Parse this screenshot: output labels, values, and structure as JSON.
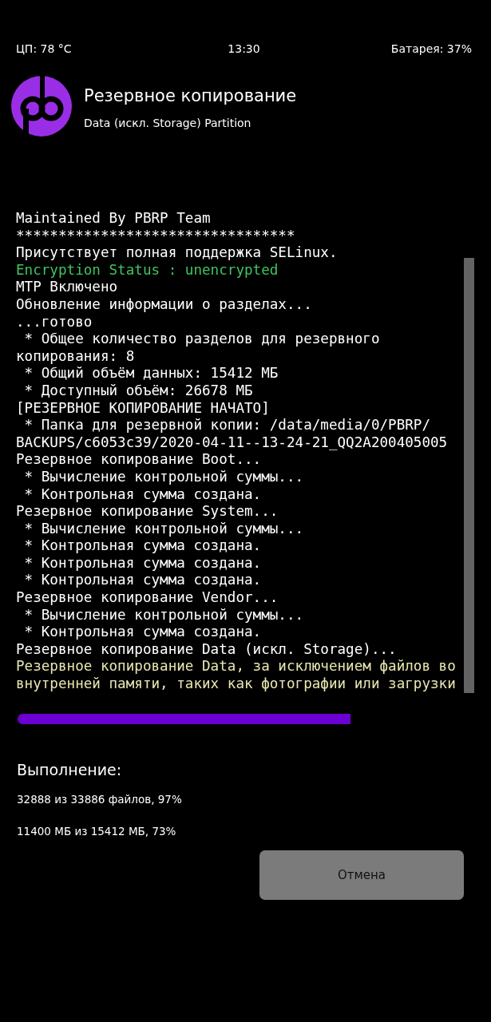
{
  "status_bar": {
    "cpu": "ЦП: 78 °C",
    "time": "13:30",
    "battery": "Батарея: 37%"
  },
  "header": {
    "title": "Резервное копирование",
    "subtitle": "Data (искл. Storage) Partition"
  },
  "console": {
    "lines": [
      {
        "text": "Maintained By PBRP Team",
        "kind": "plain"
      },
      {
        "text": "*********************************",
        "kind": "plain"
      },
      {
        "text": "Присутствует полная поддержка SELinux.",
        "kind": "plain"
      },
      {
        "text": "Encryption Status : unencrypted",
        "kind": "success"
      },
      {
        "text": "MTP Включено",
        "kind": "plain"
      },
      {
        "text": "Обновление информации о разделах...",
        "kind": "plain"
      },
      {
        "text": "...готово",
        "kind": "plain"
      },
      {
        "text": " * Общее количество разделов для резервного",
        "kind": "plain"
      },
      {
        "text": "копирования: 8",
        "kind": "plain"
      },
      {
        "text": " * Общий объём данных: 15412 МБ",
        "kind": "plain"
      },
      {
        "text": " * Доступный объём: 26678 МБ",
        "kind": "plain"
      },
      {
        "text": "[РЕЗЕРВНОЕ КОПИРОВАНИЕ НАЧАТО]",
        "kind": "plain"
      },
      {
        "text": " * Папка для резервной копии: /data/media/0/PBRP/",
        "kind": "plain"
      },
      {
        "text": "BACKUPS/c6053c39/2020-04-11--13-24-21_QQ2A200405005",
        "kind": "plain"
      },
      {
        "text": "Резервное копирование Boot...",
        "kind": "plain"
      },
      {
        "text": " * Вычисление контрольной суммы...",
        "kind": "plain"
      },
      {
        "text": " * Контрольная сумма создана.",
        "kind": "plain"
      },
      {
        "text": "Резервное копирование System...",
        "kind": "plain"
      },
      {
        "text": " * Вычисление контрольной суммы...",
        "kind": "plain"
      },
      {
        "text": " * Контрольная сумма создана.",
        "kind": "plain"
      },
      {
        "text": " * Контрольная сумма создана.",
        "kind": "plain"
      },
      {
        "text": " * Контрольная сумма создана.",
        "kind": "plain"
      },
      {
        "text": "Резервное копирование Vendor...",
        "kind": "plain"
      },
      {
        "text": " * Вычисление контрольной суммы...",
        "kind": "plain"
      },
      {
        "text": " * Контрольная сумма создана.",
        "kind": "plain"
      },
      {
        "text": "Резервное копирование Data (искл. Storage)...",
        "kind": "plain"
      },
      {
        "text": "Резервное копирование Data, за исключением файлов во",
        "kind": "notice"
      },
      {
        "text": "внутренней памяти, таких как фотографии или загрузки",
        "kind": "notice"
      }
    ]
  },
  "summary": {
    "label": "Выполнение:",
    "files": "32888 из 33886 файлов, 97%",
    "size": "11400 МБ из 15412 МБ, 73%"
  },
  "buttons": [
    "Отмена"
  ]
}
